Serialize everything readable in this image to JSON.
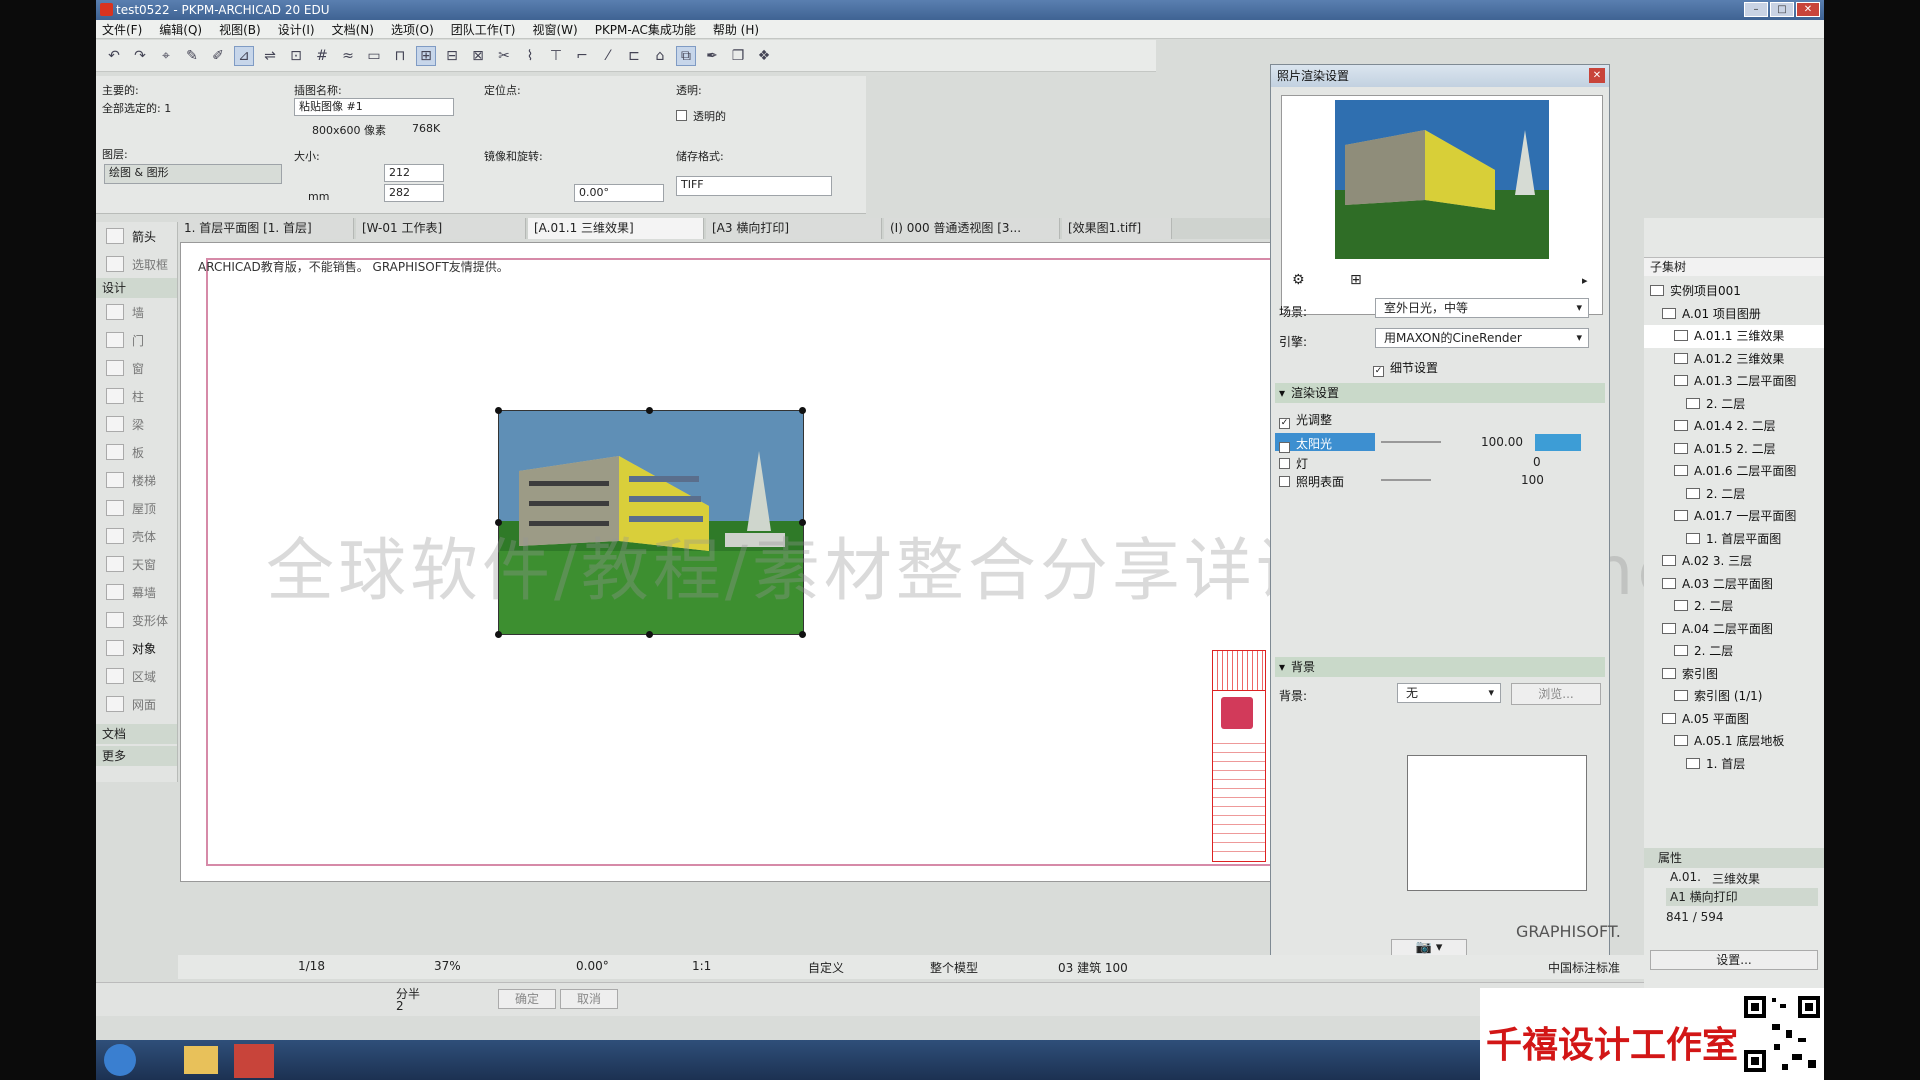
{
  "window": {
    "title": "test0522 - PKPM-ARCHICAD 20 EDU"
  },
  "menu": [
    "文件(F)",
    "编辑(Q)",
    "视图(B)",
    "设计(I)",
    "文档(N)",
    "选项(O)",
    "团队工作(T)",
    "视窗(W)",
    "PKPM-AC集成功能",
    "帮助 (H)"
  ],
  "infobox": {
    "main_label": "主要的:",
    "selected": "全部选定的: 1",
    "layer_label": "图层:",
    "layer_value": "绘图 & 图形",
    "pic_name_label": "插图名称:",
    "pic_name_value": "粘贴图像 #1",
    "resolution": "800x600 像素",
    "filesize": "768K",
    "size_label": "大小:",
    "width": "212",
    "height": "282",
    "unit": "mm",
    "anchor_label": "定位点:",
    "mirror_label": "镜像和旋转:",
    "angle": "0.00°",
    "transparent_label": "透明:",
    "transparent_check": "透明的",
    "format_label": "储存格式:",
    "format_value": "TIFF"
  },
  "tabs": [
    "1. 首层平面图 [1. 首层]",
    "[W-01 工作表]",
    "[A.01.1 三维效果]",
    "[A3 横向打印]",
    "(I) 000 普通透视图 [3...",
    "[效果图1.tiff]"
  ],
  "toolbox": {
    "arrow": "箭头",
    "marquee": "选取框",
    "design_group": "设计",
    "tools": [
      "墙",
      "门",
      "窗",
      "柱",
      "梁",
      "板",
      "楼梯",
      "屋顶",
      "壳体",
      "天窗",
      "幕墙",
      "变形体",
      "对象",
      "区域",
      "网面"
    ],
    "doc_group": "文档",
    "more_group": "更多"
  },
  "canvas": {
    "notice": "ARCHICAD教育版，不能销售。 GRAPHISOFT友情提供。",
    "watermark": "全球软件/教程/素材整合分享详询V信huahes4"
  },
  "render_dialog": {
    "title": "照片渲染设置",
    "scene_label": "场景:",
    "scene_value": "室外日光，中等",
    "engine_label": "引擎:",
    "engine_value": "用MAXON的CineRender",
    "detail_label": "细节设置",
    "render_section": "渲染设置",
    "light_adjust": "光调整",
    "sun_label": "太阳光",
    "sun_value": "100.00",
    "lamp_label": "灯",
    "lamp_value": "0",
    "surface_label": "照明表面",
    "surface_value": "100",
    "bg_section": "背景",
    "bg_label": "背景:",
    "bg_value": "无",
    "browse": "浏览..."
  },
  "right_panel": {
    "subset_label": "子集树",
    "tree": [
      {
        "label": "实例项目001",
        "level": 0
      },
      {
        "label": "A.01 项目图册",
        "level": 1
      },
      {
        "label": "A.01.1 三维效果",
        "level": 2,
        "selected": true
      },
      {
        "label": "A.01.2 三维效果",
        "level": 2
      },
      {
        "label": "A.01.3 二层平面图",
        "level": 2
      },
      {
        "label": "2. 二层",
        "level": 3
      },
      {
        "label": "A.01.4 2. 二层",
        "level": 2
      },
      {
        "label": "A.01.5 2. 二层",
        "level": 2
      },
      {
        "label": "A.01.6 二层平面图",
        "level": 2
      },
      {
        "label": "2. 二层",
        "level": 3
      },
      {
        "label": "A.01.7 一层平面图",
        "level": 2
      },
      {
        "label": "1. 首层平面图",
        "level": 3
      },
      {
        "label": "A.02 3. 三层",
        "level": 1
      },
      {
        "label": "A.03 二层平面图",
        "level": 1
      },
      {
        "label": "2. 二层",
        "level": 2
      },
      {
        "label": "A.04 二层平面图",
        "level": 1
      },
      {
        "label": "2. 二层",
        "level": 2
      },
      {
        "label": "索引图",
        "level": 1
      },
      {
        "label": "索引图 (1/1)",
        "level": 2
      },
      {
        "label": "A.05 平面图",
        "level": 1
      },
      {
        "label": "A.05.1 底层地板",
        "level": 2
      },
      {
        "label": "1. 首层",
        "level": 3
      }
    ],
    "props_label": "属性",
    "prop_id": "A.01.",
    "prop_name": "三维效果",
    "prop_layout": "A1 横向打印",
    "prop_size": "841 / 594",
    "settings_btn": "设置..."
  },
  "status": {
    "page": "1/18",
    "zoom": "37%",
    "angle": "0.00°",
    "scale": "1:1",
    "custom": "自定义",
    "model": "整个模型",
    "layer": "03 建筑 100",
    "std": "中国标注标准",
    "graphisoft": "GRAPHISOFT."
  },
  "bottombar": {
    "split_label": "分半",
    "split_value": "2",
    "ok": "确定",
    "cancel": "取消"
  },
  "brand": {
    "studio_name": "千禧设计工作室"
  }
}
